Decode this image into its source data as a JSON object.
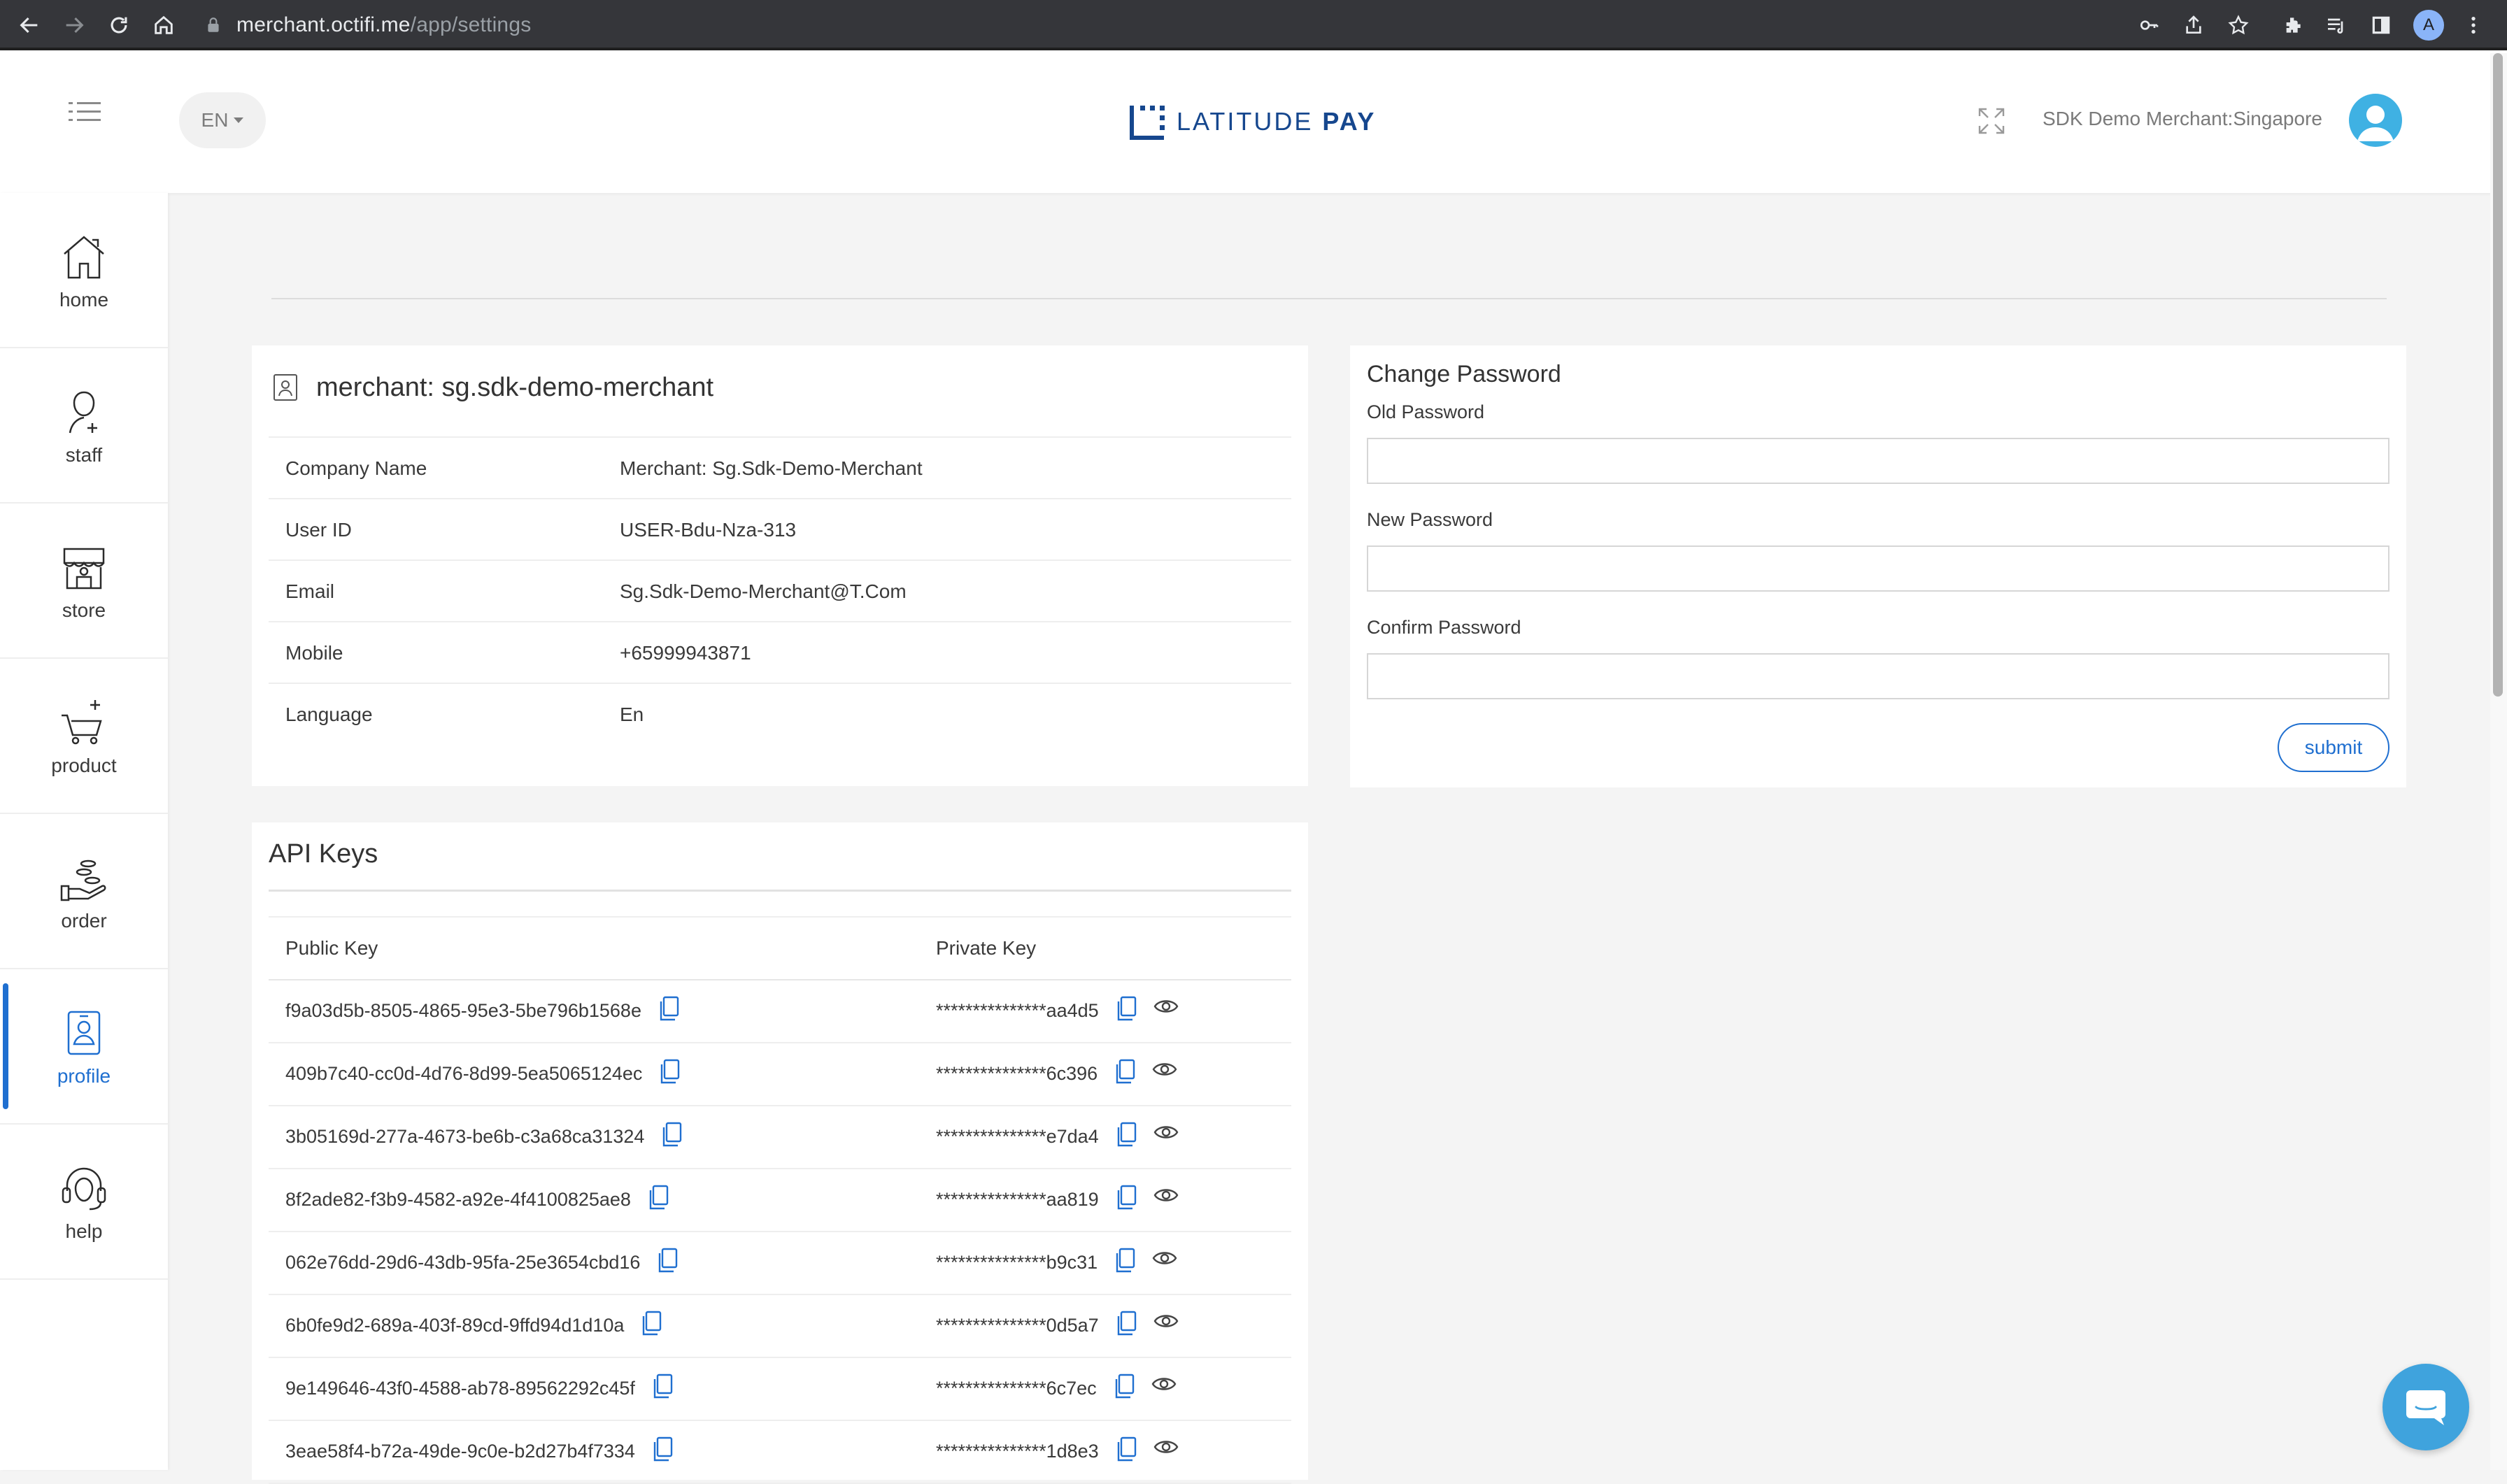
{
  "browser": {
    "url_host": "merchant.octifi.me",
    "url_path": "/app/settings",
    "profile_initial": "A"
  },
  "header": {
    "lang": "EN",
    "logo_text_1": "LATITUDE",
    "logo_text_2": "PAY",
    "merchant_name": "SDK Demo Merchant:Singapore"
  },
  "sidebar": {
    "items": [
      {
        "label": "home",
        "icon": "home-icon"
      },
      {
        "label": "staff",
        "icon": "staff-icon"
      },
      {
        "label": "store",
        "icon": "store-icon"
      },
      {
        "label": "product",
        "icon": "cart-icon"
      },
      {
        "label": "order",
        "icon": "order-icon"
      },
      {
        "label": "profile",
        "icon": "profile-icon",
        "active": true
      },
      {
        "label": "help",
        "icon": "headset-icon"
      }
    ]
  },
  "merchant": {
    "title": "merchant: sg.sdk-demo-merchant",
    "rows": [
      {
        "key": "Company Name",
        "value": "Merchant: Sg.Sdk-Demo-Merchant"
      },
      {
        "key": "User ID",
        "value": "USER-Bdu-Nza-313"
      },
      {
        "key": "Email",
        "value": "Sg.Sdk-Demo-Merchant@T.Com"
      },
      {
        "key": "Mobile",
        "value": "+65999943871"
      },
      {
        "key": "Language",
        "value": "En"
      }
    ]
  },
  "password": {
    "title": "Change Password",
    "old_label": "Old Password",
    "new_label": "New Password",
    "confirm_label": "Confirm Password",
    "old_value": "",
    "new_value": "",
    "confirm_value": "",
    "submit_label": "submit"
  },
  "api": {
    "title": "API Keys",
    "col_public": "Public Key",
    "col_private": "Private Key",
    "keys": [
      {
        "public": "f9a03d5b-8505-4865-95e3-5be796b1568e",
        "private": "***************aa4d5"
      },
      {
        "public": "409b7c40-cc0d-4d76-8d99-5ea5065124ec",
        "private": "***************6c396"
      },
      {
        "public": "3b05169d-277a-4673-be6b-c3a68ca31324",
        "private": "***************e7da4"
      },
      {
        "public": "8f2ade82-f3b9-4582-a92e-4f4100825ae8",
        "private": "***************aa819"
      },
      {
        "public": "062e76dd-29d6-43db-95fa-25e3654cbd16",
        "private": "***************b9c31"
      },
      {
        "public": "6b0fe9d2-689a-403f-89cd-9ffd94d1d10a",
        "private": "***************0d5a7"
      },
      {
        "public": "9e149646-43f0-4588-ab78-89562292c45f",
        "private": "***************6c7ec"
      },
      {
        "public": "3eae58f4-b72a-49de-9c0e-b2d27b4f7334",
        "private": "***************1d8e3"
      }
    ]
  },
  "colors": {
    "accent": "#1f6fd0",
    "brand": "#16478e",
    "chat": "#3fa3dd"
  }
}
